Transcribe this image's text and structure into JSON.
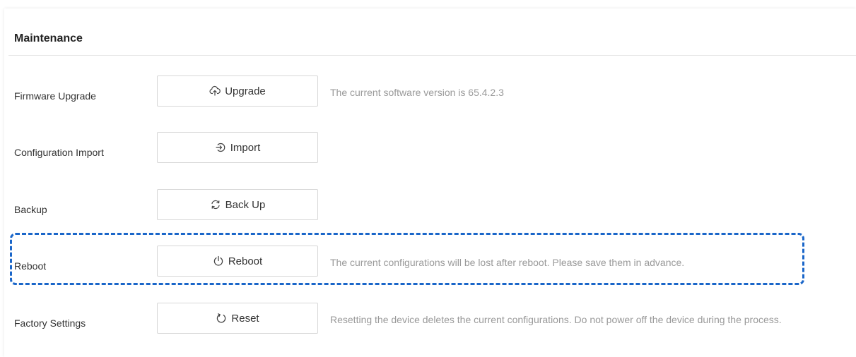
{
  "section": {
    "title": "Maintenance"
  },
  "rows": [
    {
      "label": "Firmware Upgrade",
      "button": "Upgrade",
      "icon": "cloud-upload-icon",
      "description": "The current software version is 65.4.2.3"
    },
    {
      "label": "Configuration Import",
      "button": "Import",
      "icon": "import-icon",
      "description": ""
    },
    {
      "label": "Backup",
      "button": "Back Up",
      "icon": "sync-arrows-icon",
      "description": ""
    },
    {
      "label": "Reboot",
      "button": "Reboot",
      "icon": "power-icon",
      "description": "The current configurations will be lost after reboot. Please save them in advance."
    },
    {
      "label": "Factory Settings",
      "button": "Reset",
      "icon": "reset-icon",
      "description": "Resetting the device deletes the current configurations. Do not power off the device during the process."
    }
  ],
  "highlight": {
    "color": "#1a66c9",
    "target": "Reboot"
  }
}
